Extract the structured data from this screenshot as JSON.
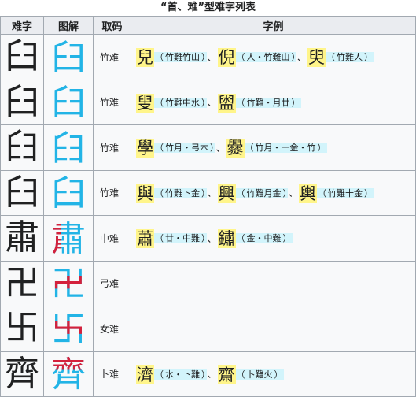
{
  "caption": "“首、难”型难字列表",
  "headers": [
    "难字",
    "图解",
    "取码",
    "字例"
  ],
  "rows": [
    {
      "glyph": "臼",
      "top": "臼",
      "code": "竹难",
      "examples": [
        {
          "char": "兒",
          "note": "竹難竹山"
        },
        {
          "char": "倪",
          "note": "人・竹難山"
        },
        {
          "char": "臾",
          "note": "竹難人"
        }
      ]
    },
    {
      "glyph": "臼",
      "top": "臼",
      "code": "竹难",
      "examples": [
        {
          "char": "叟",
          "note": "竹難中水"
        },
        {
          "char": "盥",
          "note": "竹難・月廿"
        }
      ]
    },
    {
      "glyph": "𦥑",
      "top": "𦥑",
      "code": "竹难",
      "examples": [
        {
          "char": "學",
          "note": "竹月・弓木"
        },
        {
          "char": "爨",
          "note": "竹月・一金・竹"
        }
      ]
    },
    {
      "glyph": "臼",
      "top": "臼",
      "code": "竹难",
      "examples": [
        {
          "char": "與",
          "note": "竹難卜金"
        },
        {
          "char": "興",
          "note": "竹難月金"
        },
        {
          "char": "輿",
          "note": "竹難十金"
        }
      ]
    },
    {
      "glyph": "肅",
      "top": "肅",
      "code": "中难",
      "examples": [
        {
          "char": "蕭",
          "note": "廿・中難"
        },
        {
          "char": "鏽",
          "note": "金・中難"
        }
      ]
    },
    {
      "glyph": "卍",
      "top": "卍",
      "code": "弓难",
      "examples": []
    },
    {
      "glyph": "卐",
      "top": "卐",
      "code": "女难",
      "examples": []
    },
    {
      "glyph": "齊",
      "top": "齊",
      "code": "卜难",
      "examples": [
        {
          "char": "濟",
          "note": "水・卜難"
        },
        {
          "char": "齋",
          "note": "卜難火"
        }
      ]
    }
  ],
  "colors": {
    "highlight": "#fff58a",
    "note_bg": "#d2f4fb",
    "blue": "#22b4e6",
    "red": "#d4213c"
  }
}
